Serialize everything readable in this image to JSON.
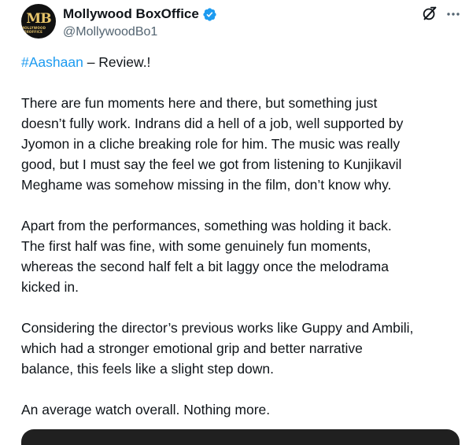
{
  "author": {
    "display_name": "Mollywood BoxOffice",
    "handle": "@MollywoodBo1",
    "avatar_text": "MB",
    "avatar_subtext": "MOLLYWOOD BOXOFFICE",
    "verified": true
  },
  "actions": {
    "grok_icon": "grok-icon",
    "more_icon": "more-icon"
  },
  "tweet": {
    "hashtag": "#Aashaan",
    "title_rest": " – Review.!",
    "paragraphs": [
      "There are fun moments here and there, but something just\ndoesn’t fully work. Indrans did a hell of a job, well supported by\nJyomon in a cliche breaking role for him. The music was really\ngood, but I must say the feel we got from listening to Kunjikavil\nMeghame was somehow missing in the film, don’t know why.",
      "Apart from the performances, something was holding it back.\nThe first half was fine, with some genuinely fun moments,\nwhereas the second half felt a bit laggy once the melodrama\nkicked in.",
      "Considering the director’s previous works like Guppy and Ambili,\nwhich had a stronger emotional grip and better narrative\nbalance, this feels like a slight step down.",
      "An average watch overall. Nothing more."
    ]
  },
  "colors": {
    "link": "#1d9bf0",
    "text": "#0f1419",
    "secondary": "#536471",
    "verified": "#1d9bf0"
  }
}
